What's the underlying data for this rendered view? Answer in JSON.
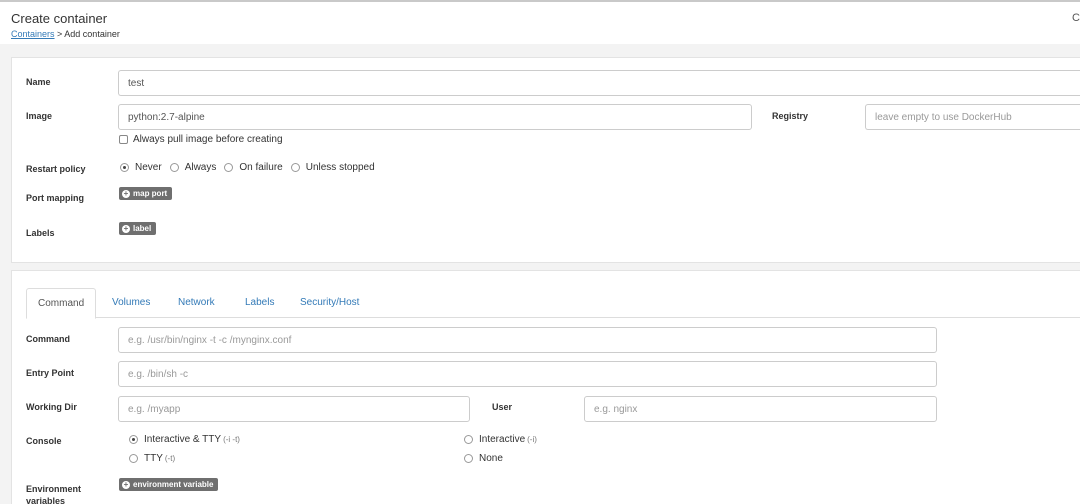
{
  "header": {
    "title": "Create container",
    "breadcrumb_link": "Containers",
    "breadcrumb_rest": " > Add container",
    "corner_glyph": "C"
  },
  "form": {
    "name_label": "Name",
    "name_value": "test",
    "image_label": "Image",
    "image_value": "python:2.7-alpine",
    "registry_label": "Registry",
    "registry_placeholder": "leave empty to use DockerHub",
    "always_pull_label": "Always pull image before creating",
    "restart_label": "Restart policy",
    "restart_options": [
      "Never",
      "Always",
      "On failure",
      "Unless stopped"
    ],
    "restart_selected": "Never",
    "port_label": "Port mapping",
    "map_port_button": "map port",
    "labels_label": "Labels",
    "label_button": "label"
  },
  "tabs": [
    "Command",
    "Volumes",
    "Network",
    "Labels",
    "Security/Host"
  ],
  "active_tab": "Command",
  "command": {
    "command_label": "Command",
    "command_placeholder": "e.g. /usr/bin/nginx -t -c /mynginx.conf",
    "entry_label": "Entry Point",
    "entry_placeholder": "e.g. /bin/sh -c",
    "workdir_label": "Working Dir",
    "workdir_placeholder": "e.g. /myapp",
    "user_label": "User",
    "user_placeholder": "e.g. nginx",
    "console_label": "Console",
    "console_options": {
      "it": {
        "label": "Interactive & TTY",
        "hint": "(-i -t)"
      },
      "i": {
        "label": "Interactive",
        "hint": "(-i)"
      },
      "t": {
        "label": "TTY",
        "hint": "(-t)"
      },
      "none": {
        "label": "None"
      }
    },
    "console_selected": "Interactive & TTY",
    "env_label": "Environment variables",
    "env_button": "environment variable"
  },
  "colors": {
    "link": "#337ab7",
    "badge": "#6f6f6f",
    "background": "#f3f3f3"
  }
}
